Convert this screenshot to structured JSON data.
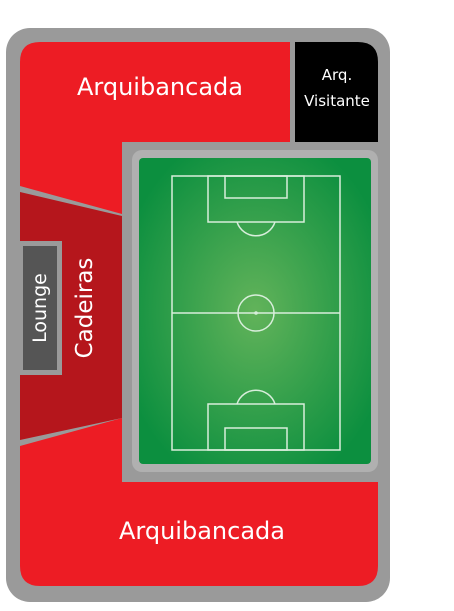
{
  "sections": {
    "arquibancada_top": {
      "label": "Arquibancada"
    },
    "visitante": {
      "label_line1": "Arq.",
      "label_line2": "Visitante"
    },
    "cadeiras": {
      "label": "Cadeiras"
    },
    "lounge": {
      "label": "Lounge"
    },
    "arquibancada_bottom": {
      "label": "Arquibancada"
    }
  },
  "colors": {
    "frame": "#9a9a9a",
    "stand_red": "#ed1c24",
    "cadeiras_red": "#b5161c",
    "visitor_black": "#000000",
    "lounge_gray": "#555555",
    "pitch_green_center": "#62b35a",
    "pitch_green_edge": "#0c8f3f",
    "pitch_border": "#b0b0b0"
  }
}
